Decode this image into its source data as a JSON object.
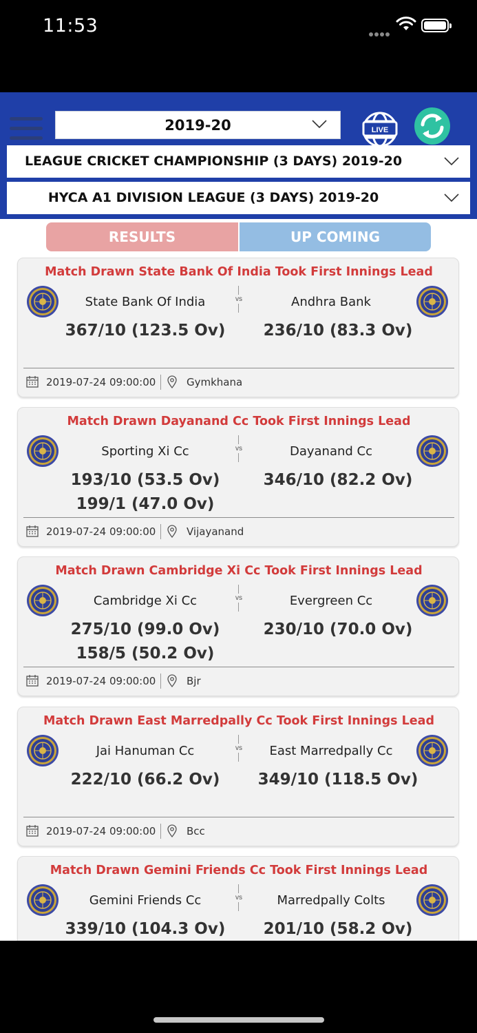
{
  "status_bar": {
    "time": "11:53"
  },
  "header": {
    "season": "2019-20",
    "championship": "LEAGUE CRICKET CHAMPIONSHIP (3 DAYS) 2019-20",
    "division": "HYCA A1 DIVISION LEAGUE (3 DAYS) 2019-20",
    "live_label": "LIVE"
  },
  "tabs": {
    "results": "RESULTS",
    "upcoming": "UP COMING",
    "active": "results"
  },
  "vs_label": "vs",
  "matches": [
    {
      "result": "Match Drawn State Bank Of India Took First Innings Lead",
      "team_a": "State Bank Of India",
      "team_b": "Andhra Bank",
      "score_a1": "367/10 (123.5 Ov)",
      "score_a2": "",
      "score_b1": "236/10 (83.3 Ov)",
      "score_b2": "",
      "datetime": "2019-07-24 09:00:00",
      "venue": "Gymkhana"
    },
    {
      "result": "Match Drawn Dayanand Cc Took First Innings Lead",
      "team_a": "Sporting Xi Cc",
      "team_b": "Dayanand Cc",
      "score_a1": "193/10 (53.5 Ov)",
      "score_a2": "199/1 (47.0 Ov)",
      "score_b1": "346/10 (82.2 Ov)",
      "score_b2": "",
      "datetime": "2019-07-24 09:00:00",
      "venue": "Vijayanand"
    },
    {
      "result": "Match Drawn Cambridge Xi Cc Took First Innings Lead",
      "team_a": "Cambridge Xi Cc",
      "team_b": "Evergreen Cc",
      "score_a1": "275/10 (99.0 Ov)",
      "score_a2": "158/5 (50.2 Ov)",
      "score_b1": "230/10 (70.0 Ov)",
      "score_b2": "",
      "datetime": "2019-07-24 09:00:00",
      "venue": "Bjr"
    },
    {
      "result": "Match Drawn East Marredpally Cc Took First Innings Lead",
      "team_a": "Jai Hanuman Cc",
      "team_b": "East Marredpally Cc",
      "score_a1": "222/10 (66.2 Ov)",
      "score_a2": "",
      "score_b1": "349/10 (118.5 Ov)",
      "score_b2": "",
      "datetime": "2019-07-24 09:00:00",
      "venue": "Bcc"
    },
    {
      "result": "Match Drawn Gemini Friends Cc Took First Innings Lead",
      "team_a": "Gemini Friends Cc",
      "team_b": "Marredpally Colts",
      "score_a1": "339/10 (104.3 Ov)",
      "score_a2": "",
      "score_b1": "201/10 (58.2 Ov)",
      "score_b2": "",
      "datetime": "",
      "venue": ""
    }
  ],
  "colors": {
    "header_blue": "#1f3fa8",
    "result_red": "#d23b3b",
    "tab_results": "#e8a3a3",
    "tab_upcoming": "#94bde3",
    "refresh_green": "#2fc2a2"
  }
}
